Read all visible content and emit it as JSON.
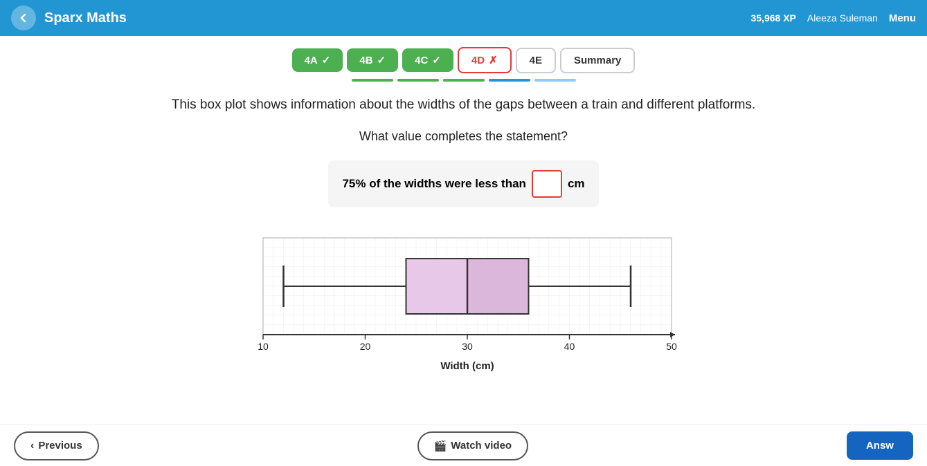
{
  "header": {
    "back_icon": "chevron-left",
    "title": "Sparx Maths",
    "xp": "35,968 XP",
    "user": "Aleeza Suleman",
    "menu": "Menu"
  },
  "tabs": [
    {
      "id": "4A",
      "label": "4A",
      "state": "complete",
      "icon": "✓"
    },
    {
      "id": "4B",
      "label": "4B",
      "state": "complete",
      "icon": "✓"
    },
    {
      "id": "4C",
      "label": "4C",
      "state": "complete",
      "icon": "✓"
    },
    {
      "id": "4D",
      "label": "4D",
      "state": "active",
      "icon": "✗"
    },
    {
      "id": "4E",
      "label": "4E",
      "state": "plain"
    },
    {
      "id": "summary",
      "label": "Summary",
      "state": "plain"
    }
  ],
  "question": {
    "text": "This box plot shows information about the widths of the gaps between a train and different platforms.",
    "sub": "What value completes the statement?",
    "statement": {
      "prefix": "75% of the widths were less than",
      "suffix": "cm",
      "placeholder": ""
    }
  },
  "chart": {
    "x_min": 10,
    "x_max": 50,
    "x_labels": [
      "10",
      "20",
      "30",
      "40",
      "50"
    ],
    "x_axis_label": "Width (cm)",
    "whisker_min": 12,
    "q1": 24,
    "median": 30,
    "q3": 36,
    "whisker_max": 46
  },
  "footer": {
    "prev_label": "Previous",
    "watch_label": "Watch video",
    "answer_label": "Answ"
  }
}
